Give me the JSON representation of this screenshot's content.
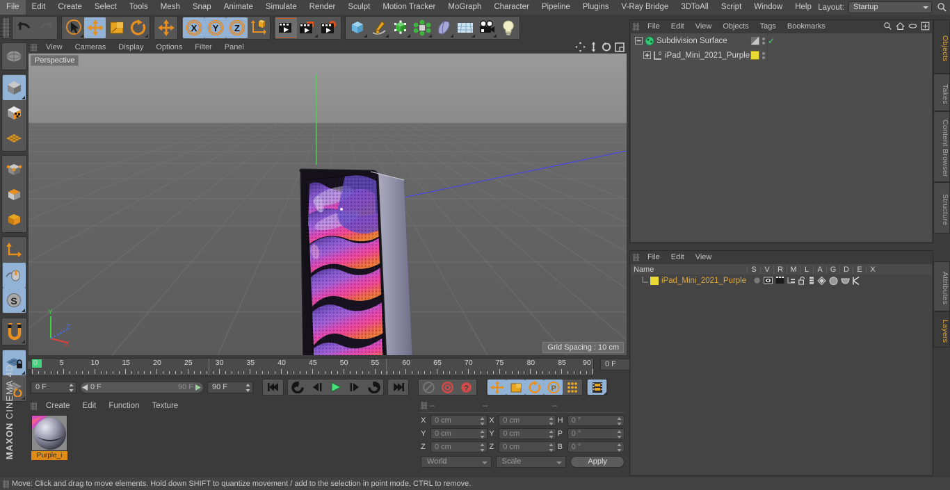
{
  "app": {
    "brand_top": "MAXON",
    "brand_bottom": "CINEMA 4D"
  },
  "top_menu": {
    "items": [
      "File",
      "Edit",
      "Create",
      "Select",
      "Tools",
      "Mesh",
      "Snap",
      "Animate",
      "Simulate",
      "Render",
      "Sculpt",
      "Motion Tracker",
      "MoGraph",
      "Character",
      "Pipeline",
      "Plugins",
      "V-Ray Bridge",
      "3DToAll",
      "Script",
      "Window",
      "Help"
    ],
    "layout_label": "Layout:",
    "layout_value": "Startup",
    "search_icon": "search-icon"
  },
  "toolbar": {
    "buttons": [
      {
        "name": "undo-button",
        "icon": "undo-arrow-icon",
        "state": "normal"
      },
      {
        "name": "redo-button",
        "icon": "redo-arrow-icon",
        "state": "disabled"
      },
      {
        "name": "live-selection-tool",
        "icon": "cursor-circle-icon",
        "state": "normal"
      },
      {
        "name": "move-tool",
        "icon": "move-arrows-icon",
        "state": "selected"
      },
      {
        "name": "scale-tool",
        "icon": "scale-box-icon",
        "state": "normal"
      },
      {
        "name": "rotate-tool",
        "icon": "rotate-circle-icon",
        "state": "normal"
      },
      {
        "name": "move-alt-tool",
        "icon": "move-arrows-icon",
        "state": "normal"
      },
      {
        "name": "axis-x-lock",
        "icon": "x-axis-icon",
        "state": "selected",
        "label": "X"
      },
      {
        "name": "axis-y-lock",
        "icon": "y-axis-icon",
        "state": "selected",
        "label": "Y"
      },
      {
        "name": "axis-z-lock",
        "icon": "z-axis-icon",
        "state": "selected",
        "label": "Z"
      },
      {
        "name": "world-object-coordinates",
        "icon": "axis-cube-icon",
        "state": "normal"
      },
      {
        "name": "render-view-button",
        "icon": "clapperboard-icon",
        "state": "active"
      },
      {
        "name": "render-to-picture-viewer-button",
        "icon": "clapperboard-window-icon",
        "state": "normal"
      },
      {
        "name": "render-settings-button",
        "icon": "clapperboard-gear-icon",
        "state": "normal"
      },
      {
        "name": "add-cube-button",
        "icon": "cube-icon",
        "state": "normal"
      },
      {
        "name": "add-spline-button",
        "icon": "pen-spline-icon",
        "state": "normal"
      },
      {
        "name": "add-generator-button",
        "icon": "green-cube-nurbs-icon",
        "state": "normal"
      },
      {
        "name": "add-array-button",
        "icon": "green-array-icon",
        "state": "normal"
      },
      {
        "name": "add-deformer-button",
        "icon": "bend-deformer-icon",
        "state": "normal"
      },
      {
        "name": "add-scene-object-button",
        "icon": "floor-grid-icon",
        "state": "normal"
      },
      {
        "name": "add-camera-button",
        "icon": "camera-icon",
        "state": "normal"
      },
      {
        "name": "add-light-button",
        "icon": "lightbulb-icon",
        "state": "normal"
      }
    ]
  },
  "left_toolbar": {
    "buttons": [
      {
        "name": "undo-view-button",
        "icon": "globe-sphere-icon",
        "state": "normal"
      },
      {
        "name": "make-editable-button",
        "icon": "gray-cube-icon",
        "state": "selected"
      },
      {
        "name": "model-mode-button",
        "icon": "checker-cube-icon",
        "state": "normal"
      },
      {
        "name": "texture-mode-button",
        "icon": "texture-grid-icon",
        "state": "normal"
      },
      {
        "name": "points-mode-button",
        "icon": "points-cube-icon",
        "state": "normal"
      },
      {
        "name": "edges-mode-button",
        "icon": "edges-cube-icon",
        "state": "normal"
      },
      {
        "name": "polygons-mode-button",
        "icon": "polygon-cube-icon",
        "state": "normal"
      },
      {
        "name": "axis-modify-button",
        "icon": "axis-L-icon",
        "state": "normal"
      },
      {
        "name": "enable-snapping-button",
        "icon": "mouse-icon",
        "state": "selected"
      },
      {
        "name": "soft-selection-button",
        "icon": "s-sphere-icon",
        "state": "selected"
      },
      {
        "name": "magnet-tool-button",
        "icon": "magnet-icon",
        "state": "normal"
      },
      {
        "name": "workplane-lock-button",
        "icon": "grid-lock-icon",
        "state": "selected"
      },
      {
        "name": "workplane-rotate-button",
        "icon": "grid-rotate-icon",
        "state": "normal"
      }
    ]
  },
  "viewport": {
    "menu": [
      "View",
      "Cameras",
      "Display",
      "Options",
      "Filter",
      "Panel"
    ],
    "corner_icons": [
      "pan-view-icon",
      "dolly-view-icon",
      "rotate-view-icon",
      "maximize-view-icon"
    ],
    "label": "Perspective",
    "grid_spacing": "Grid Spacing : 10 cm",
    "axis_labels": {
      "x": "X",
      "y": "Y",
      "z": "Z"
    }
  },
  "timeline": {
    "ruler_min": 0,
    "ruler_max": 90,
    "major_ticks": [
      0,
      5,
      10,
      15,
      20,
      25,
      30,
      35,
      40,
      45,
      50,
      55,
      60,
      65,
      70,
      75,
      80,
      85,
      90
    ],
    "current_frame_field": "0 F",
    "start_frame_field": "0 F",
    "range_start": "0 F",
    "range_end": "90 F",
    "end_frame_field": "90 F",
    "transport": [
      {
        "name": "go-to-start-button",
        "icon": "skip-start-icon"
      },
      {
        "name": "go-to-previous-key-button",
        "icon": "prev-key-icon"
      },
      {
        "name": "step-back-button",
        "icon": "step-back-icon"
      },
      {
        "name": "play-button",
        "icon": "play-icon"
      },
      {
        "name": "step-forward-button",
        "icon": "step-forward-icon"
      },
      {
        "name": "go-to-next-key-button",
        "icon": "next-key-icon"
      },
      {
        "name": "go-to-end-button",
        "icon": "skip-end-icon"
      }
    ],
    "record_group": [
      {
        "name": "record-active-objects-button",
        "icon": "key-icon",
        "state": "disabled"
      },
      {
        "name": "autokeying-button",
        "icon": "red-circle-icon",
        "state": "normal"
      },
      {
        "name": "keyframe-help-button",
        "icon": "red-question-icon",
        "state": "normal"
      }
    ],
    "key_toggles": [
      {
        "name": "key-position-button",
        "icon": "move-arrows-icon",
        "state": "selected"
      },
      {
        "name": "key-scale-button",
        "icon": "scale-box-icon",
        "state": "selected"
      },
      {
        "name": "key-rotation-button",
        "icon": "rotate-circle-icon",
        "state": "selected"
      },
      {
        "name": "key-parameter-button",
        "icon": "p-circle-icon",
        "state": "selected"
      },
      {
        "name": "key-pla-button",
        "icon": "dots-grid-icon",
        "state": "normal"
      },
      {
        "name": "timeline-toggle-button",
        "icon": "filmstrip-icon",
        "state": "selected"
      }
    ]
  },
  "material_manager": {
    "menu": [
      "Create",
      "Edit",
      "Function",
      "Texture"
    ],
    "materials": [
      {
        "name": "Purple_i",
        "swatch": "purple-ipad-material"
      }
    ]
  },
  "coordinates": {
    "header": [
      "--",
      "--",
      "--"
    ],
    "position": {
      "label_x": "X",
      "label_y": "Y",
      "label_z": "Z",
      "x": "0 cm",
      "y": "0 cm",
      "z": "0 cm"
    },
    "size": {
      "label_x": "X",
      "label_y": "Y",
      "label_z": "Z",
      "x": "0 cm",
      "y": "0 cm",
      "z": "0 cm"
    },
    "rotation": {
      "label_h": "H",
      "label_p": "P",
      "label_b": "B",
      "h": "0 °",
      "p": "0 °",
      "b": "0 °"
    },
    "system": "World",
    "mode": "Scale",
    "apply": "Apply"
  },
  "object_manager": {
    "menu": [
      "File",
      "Edit",
      "View",
      "Objects",
      "Tags",
      "Bookmarks"
    ],
    "header_icons": [
      "search-icon",
      "home-icon",
      "ellipse-icon",
      "new-layer-icon"
    ],
    "rows": [
      {
        "name": "Subdivision Surface",
        "indent": 0,
        "icon": "subdivision-surface-icon",
        "tag_color": "#9a9a9a",
        "check": "✓",
        "expanded": true
      },
      {
        "name": "iPad_Mini_2021_Purple",
        "indent": 1,
        "icon": "null-object-icon",
        "tag_color": "#e8d935",
        "check": "",
        "expanded": false
      }
    ]
  },
  "attribute_manager": {
    "menu": [
      "File",
      "Edit",
      "View"
    ],
    "columns": [
      "Name",
      "S",
      "V",
      "R",
      "M",
      "L",
      "A",
      "G",
      "D",
      "E",
      "X"
    ],
    "rows": [
      {
        "name": "iPad_Mini_2021_Purple",
        "swatch": "#e8d935"
      }
    ]
  },
  "right_tabs": {
    "top": [
      "Objects",
      "Takes",
      "Content Browser",
      "Structure"
    ],
    "top_active": "Objects",
    "bottom": [
      "Attributes",
      "Layers"
    ],
    "bottom_active": "Layers"
  },
  "status_bar": {
    "text": "Move: Click and drag to move elements. Hold down SHIFT to quantize movement / add to the selection in point mode, CTRL to remove."
  },
  "colors": {
    "accent_orange": "#e0a83a",
    "selected_blue": "#93b3d6",
    "panel_bg": "#3b3b3b",
    "menu_bg": "#434343"
  }
}
